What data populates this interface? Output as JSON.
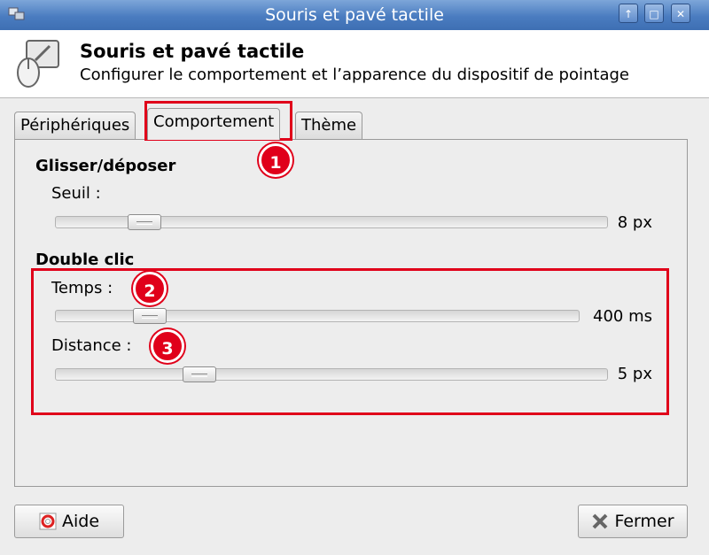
{
  "window": {
    "title": "Souris et pavé tactile",
    "buttons": [
      "↑",
      "□",
      "✕"
    ]
  },
  "header": {
    "title": "Souris et pavé tactile",
    "subtitle": "Configurer le comportement et l’apparence du dispositif de pointage"
  },
  "tabs": [
    {
      "label": "Périphériques",
      "underline": "P"
    },
    {
      "label": "Comportement",
      "underline": "C"
    },
    {
      "label": "Thème",
      "underline": "T"
    }
  ],
  "active_tab": "Comportement",
  "drag_drop": {
    "heading": "Glisser/déposer",
    "threshold": {
      "label": "Seuil :",
      "value": "8 px",
      "level": 0.16
    }
  },
  "double_click": {
    "heading": "Double clic",
    "time": {
      "label": "Temps :",
      "value": "400 ms",
      "level": 0.18
    },
    "distance": {
      "label": "Distance :",
      "value": "5 px",
      "level": 0.26
    }
  },
  "buttons": {
    "help": "Aide",
    "close": "Fermer"
  },
  "annotations": [
    "1",
    "2",
    "3"
  ],
  "colors": {
    "annotation": "#e0001a",
    "titlebar": "#4a7cc0"
  }
}
